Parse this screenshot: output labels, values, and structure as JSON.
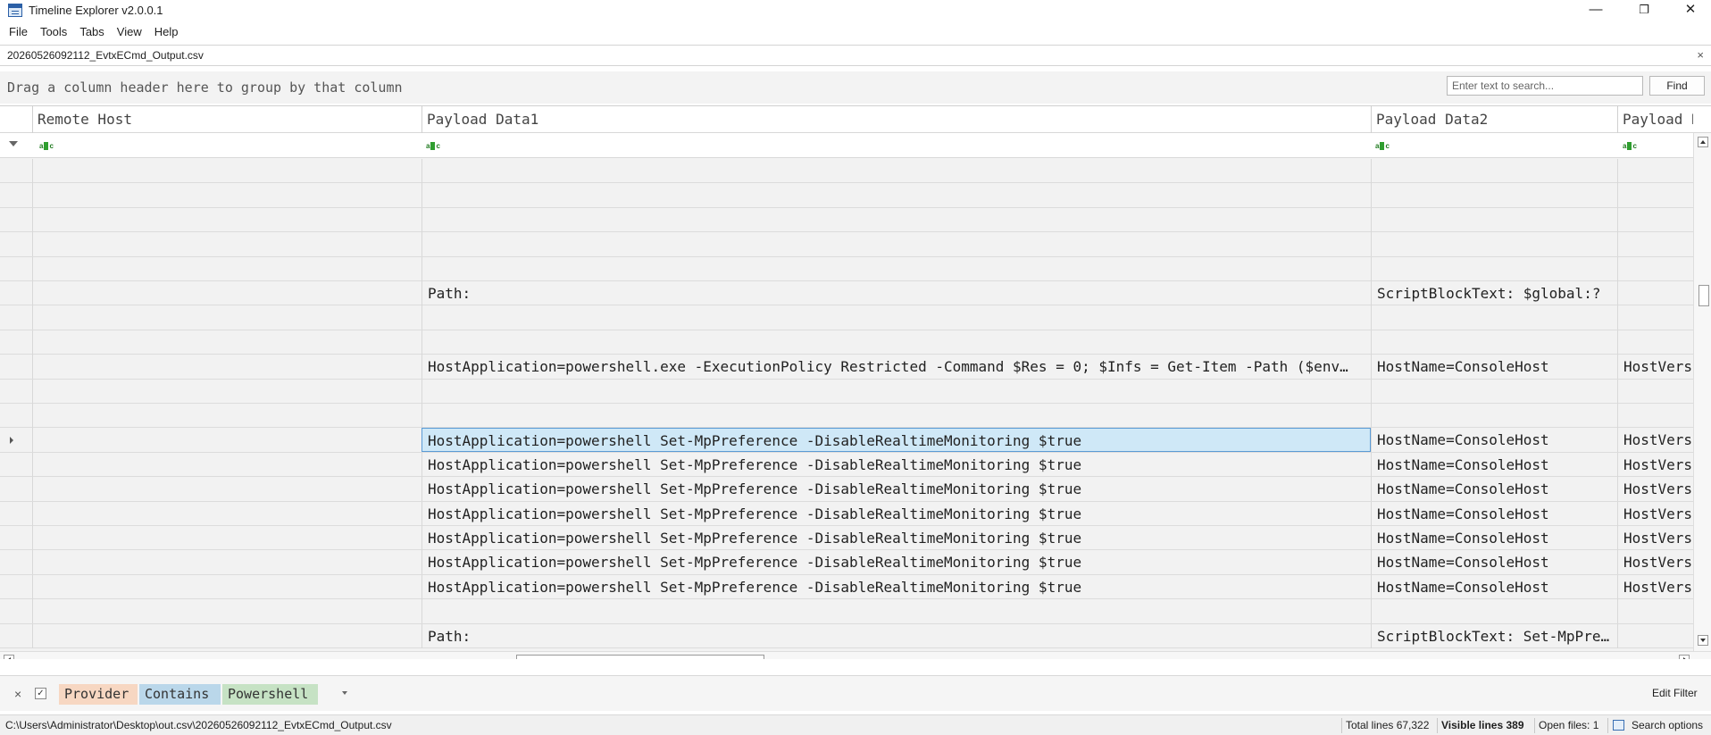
{
  "window": {
    "title": "Timeline Explorer v2.0.0.1",
    "minimize": "—",
    "restore": "❐",
    "close": "✕"
  },
  "menu": [
    "File",
    "Tools",
    "Tabs",
    "View",
    "Help"
  ],
  "file_tab": {
    "label": "20260526092112_EvtxECmd_Output.csv",
    "close": "×"
  },
  "group_panel": {
    "text": "Drag a column header here to group by that column"
  },
  "search": {
    "placeholder": "Enter text to search...",
    "find_label": "Find"
  },
  "columns": [
    {
      "key": "remote_host",
      "label": "Remote Host"
    },
    {
      "key": "payload1",
      "label": "Payload Data1"
    },
    {
      "key": "payload2",
      "label": "Payload Data2"
    },
    {
      "key": "payload3",
      "label": "Payload Da"
    }
  ],
  "filter_row_icon": "abc-filter-icon",
  "rows": [
    {
      "remote_host": "",
      "payload1": "",
      "payload2": "",
      "payload3": ""
    },
    {
      "remote_host": "",
      "payload1": "",
      "payload2": "",
      "payload3": ""
    },
    {
      "remote_host": "",
      "payload1": "",
      "payload2": "",
      "payload3": ""
    },
    {
      "remote_host": "",
      "payload1": "",
      "payload2": "",
      "payload3": ""
    },
    {
      "remote_host": "",
      "payload1": "",
      "payload2": "",
      "payload3": ""
    },
    {
      "remote_host": "",
      "payload1": "Path:",
      "payload2": "ScriptBlockText: $global:?",
      "payload3": ""
    },
    {
      "remote_host": "",
      "payload1": "",
      "payload2": "",
      "payload3": ""
    },
    {
      "remote_host": "",
      "payload1": "",
      "payload2": "",
      "payload3": ""
    },
    {
      "remote_host": "",
      "payload1": "HostApplication=powershell.exe -ExecutionPolicy Restricted -Command $Res = 0; $Infs = Get-Item -Path ($env…",
      "payload2": "HostName=ConsoleHost",
      "payload3": "HostVers:"
    },
    {
      "remote_host": "",
      "payload1": "",
      "payload2": "",
      "payload3": ""
    },
    {
      "remote_host": "",
      "payload1": "",
      "payload2": "",
      "payload3": ""
    },
    {
      "remote_host": "",
      "payload1": "HostApplication=powershell Set-MpPreference -DisableRealtimeMonitoring $true",
      "payload2": "HostName=ConsoleHost",
      "payload3": "HostVers:",
      "selected": true
    },
    {
      "remote_host": "",
      "payload1": "HostApplication=powershell Set-MpPreference -DisableRealtimeMonitoring $true",
      "payload2": "HostName=ConsoleHost",
      "payload3": "HostVers:"
    },
    {
      "remote_host": "",
      "payload1": "HostApplication=powershell Set-MpPreference -DisableRealtimeMonitoring $true",
      "payload2": "HostName=ConsoleHost",
      "payload3": "HostVers:"
    },
    {
      "remote_host": "",
      "payload1": "HostApplication=powershell Set-MpPreference -DisableRealtimeMonitoring $true",
      "payload2": "HostName=ConsoleHost",
      "payload3": "HostVers:"
    },
    {
      "remote_host": "",
      "payload1": "HostApplication=powershell Set-MpPreference -DisableRealtimeMonitoring $true",
      "payload2": "HostName=ConsoleHost",
      "payload3": "HostVers:"
    },
    {
      "remote_host": "",
      "payload1": "HostApplication=powershell Set-MpPreference -DisableRealtimeMonitoring $true",
      "payload2": "HostName=ConsoleHost",
      "payload3": "HostVers:"
    },
    {
      "remote_host": "",
      "payload1": "HostApplication=powershell Set-MpPreference -DisableRealtimeMonitoring $true",
      "payload2": "HostName=ConsoleHost",
      "payload3": "HostVers:"
    },
    {
      "remote_host": "",
      "payload1": "",
      "payload2": "",
      "payload3": ""
    },
    {
      "remote_host": "",
      "payload1": "Path:",
      "payload2": "ScriptBlockText: Set-MpPre…",
      "payload3": ""
    }
  ],
  "filter_bar": {
    "field": "Provider",
    "operator": "Contains",
    "value": "Powershell",
    "close": "×",
    "check": "✓",
    "edit_label": "Edit Filter",
    "colors": {
      "field": "#f7d7c2",
      "operator": "#bad7ea",
      "value": "#c6e2c4"
    }
  },
  "status": {
    "path": "C:\\Users\\Administrator\\Desktop\\out.csv\\20260526092112_EvtxECmd_Output.csv",
    "total_lines": "Total lines 67,322",
    "visible_lines": "Visible lines 389",
    "open_files": "Open files: 1",
    "search_options": "Search options"
  },
  "colors": {
    "selection": "#cfe8f7",
    "selection_border": "#5b9bd5"
  }
}
